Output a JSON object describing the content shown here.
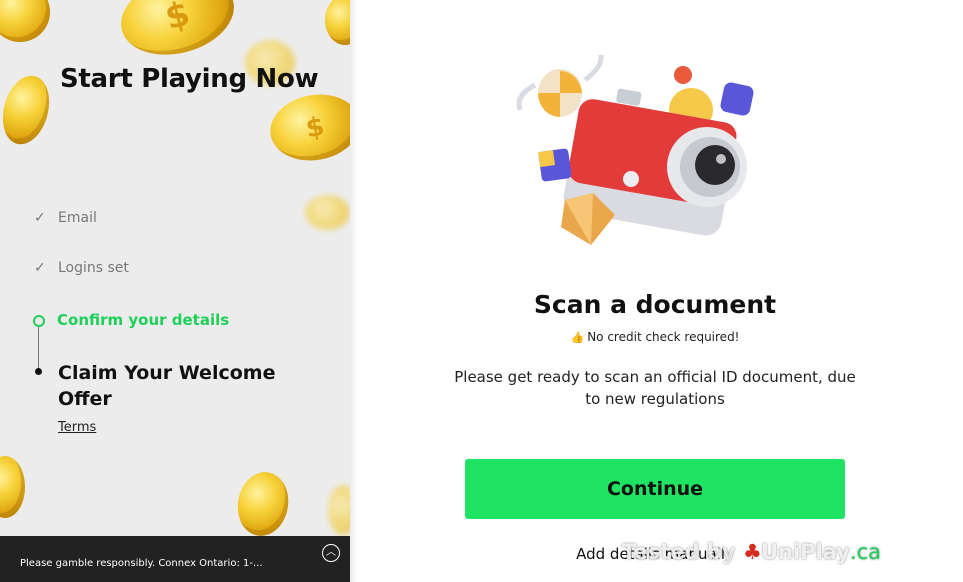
{
  "sidebar": {
    "title": "Start Playing Now",
    "steps": [
      {
        "label": "Email",
        "state": "done"
      },
      {
        "label": "Logins set",
        "state": "done"
      },
      {
        "label": "Confirm your details",
        "state": "active"
      },
      {
        "label": "Claim Your Welcome Offer",
        "state": "pending"
      }
    ],
    "terms_label": "Terms",
    "coin_symbol": "$"
  },
  "footer": {
    "text": "Please gamble responsibly. Connex Ontario: 1-...",
    "toggle_icon": "chevron-up-circle-icon"
  },
  "main": {
    "heading": "Scan a document",
    "note_icon": "thumbs-up-icon",
    "note": "No credit check required!",
    "description": "Please get ready to scan an official ID document, due to new regulations",
    "continue_label": "Continue",
    "manual_label": "Add details manually"
  },
  "watermark": {
    "prefix": "Tested by",
    "brand": "UniPlay",
    "tld": ".ca"
  },
  "colors": {
    "accent": "#1fe363",
    "active_step": "#1fcf5a",
    "footer_bg": "#222222",
    "left_bg": "#ececec"
  }
}
